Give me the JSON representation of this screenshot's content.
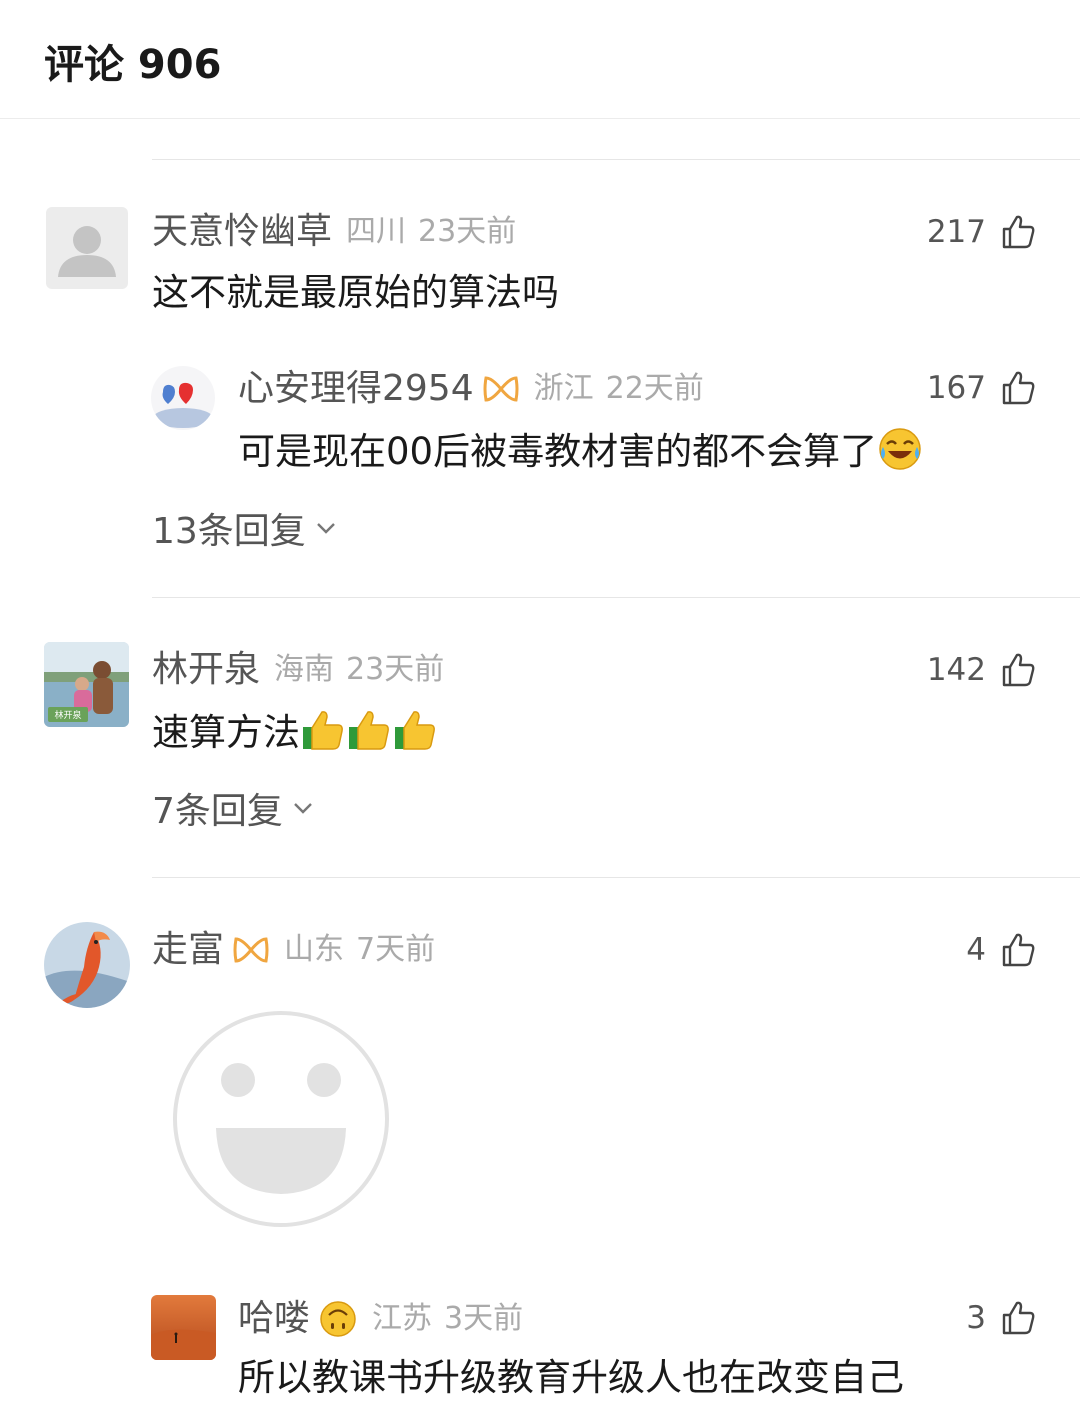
{
  "header": {
    "title": "评论 906"
  },
  "colors": {
    "username": "#555555",
    "meta": "#aaaaaa",
    "text": "#1a1a1a",
    "badge": "#f0a640",
    "divider": "#e6e6e6"
  },
  "comments": [
    {
      "username": "天意怜幽草",
      "region": "四川",
      "time": "23天前",
      "likes": "217",
      "text": "这不就是最原始的算法吗",
      "avatar_icon": "default-person-icon",
      "reply": {
        "username": "心安理得2954",
        "badge_icon": "vip-badge-icon",
        "region": "浙江",
        "time": "22天前",
        "likes": "167",
        "text": "可是现在00后被毒教材害的都不会算了",
        "trailing_emoji": "laugh-cry-emoji-icon"
      },
      "replies_label": "13条回复"
    },
    {
      "username": "林开泉",
      "region": "海南",
      "time": "23天前",
      "likes": "142",
      "text": "速算方法",
      "avatar_caption": "林开泉",
      "trailing_emoji": "thumbs-up-emoji-icon",
      "replies_label": "7条回复"
    },
    {
      "username": "走富",
      "badge_icon": "vip-badge-icon",
      "region": "山东",
      "time": "7天前",
      "likes": "4",
      "sticker_icon": "smiley-sticker-icon",
      "reply": {
        "username": "哈喽",
        "name_emoji": "upside-down-face-emoji-icon",
        "region": "江苏",
        "time": "3天前",
        "likes": "3",
        "text": "所以教课书升级教育升级人也在改变自己"
      }
    }
  ]
}
